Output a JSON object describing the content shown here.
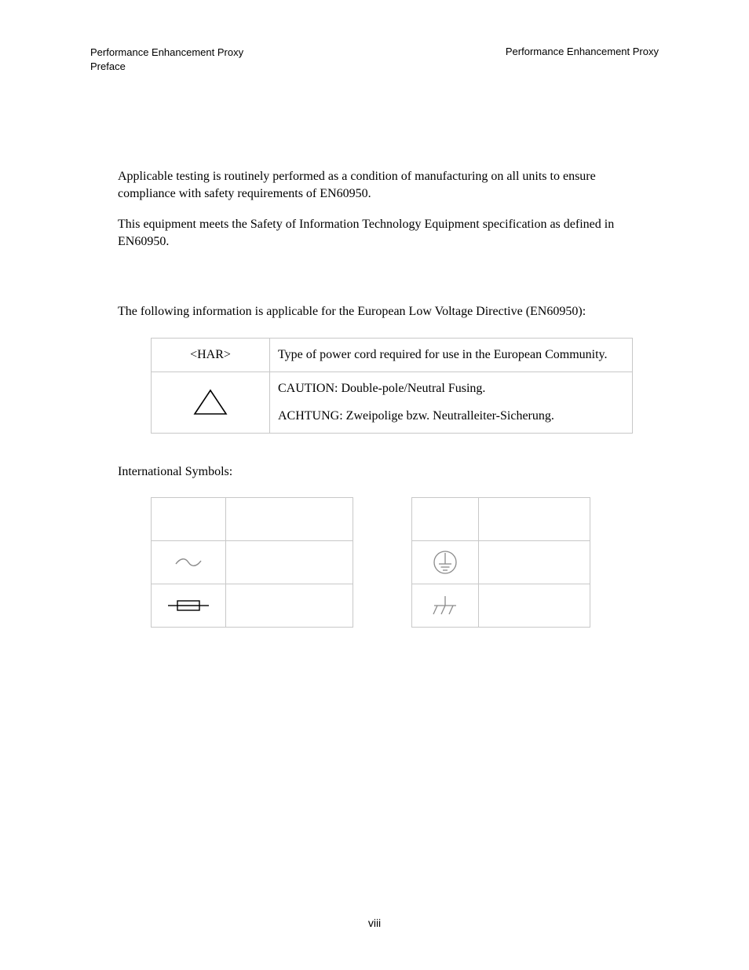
{
  "header": {
    "left_line1": "Performance Enhancement Proxy",
    "left_line2": "Preface",
    "right": "Performance Enhancement Proxy"
  },
  "body": {
    "para1": "Applicable testing is routinely performed as a condition of manufacturing on all units to ensure compliance with safety requirements of EN60950.",
    "para2": "This equipment meets the Safety of Information Technology Equipment specification as defined in EN60950.",
    "para3": "The following information is applicable for the European Low Voltage Directive (EN60950):"
  },
  "table1": {
    "row1_symbol": "<HAR>",
    "row1_desc": "Type of power cord required for use in the European Community.",
    "row2_caution": "CAUTION: Double-pole/Neutral Fusing.",
    "row2_achtung": "ACHTUNG: Zweipolige bzw. Neutralleiter-Sicherung."
  },
  "intl_heading": "International Symbols:",
  "page_number": "viii"
}
